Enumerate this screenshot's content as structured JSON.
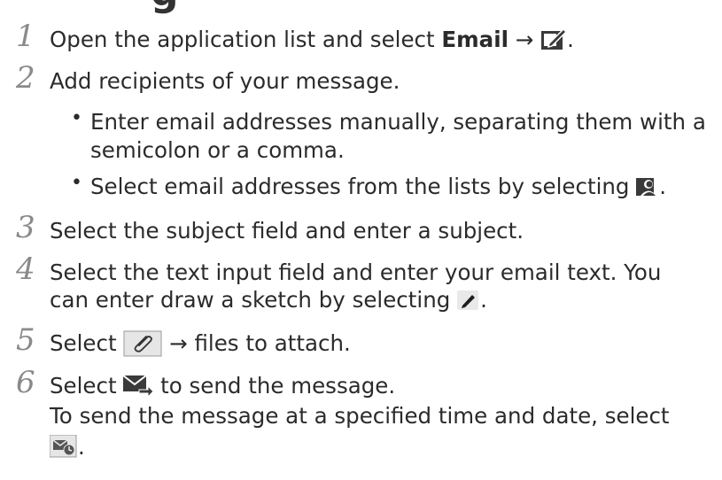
{
  "heading_partial": "g",
  "steps": [
    {
      "number": "1",
      "text_before": "Open the application list and select ",
      "bold": "Email",
      "arrow": "→",
      "icon": "compose-icon",
      "text_after": "."
    },
    {
      "number": "2",
      "text": "Add recipients of your message.",
      "bullets": [
        {
          "bullet": "•",
          "line1": "Enter email addresses manually, separating them with a",
          "line2": "semicolon or a comma."
        },
        {
          "bullet": "•",
          "text": "Select email addresses from the lists by selecting ",
          "icon": "contacts-icon",
          "text_after": "."
        }
      ]
    },
    {
      "number": "3",
      "text": "Select the subject field and enter a subject."
    },
    {
      "number": "4",
      "line1": "Select the text input field and enter your email text. You",
      "line2": "can enter draw a sketch by selecting ",
      "icon": "pen-icon",
      "text_after": "."
    },
    {
      "number": "5",
      "text_before": "Select ",
      "icon": "paperclip-icon",
      "arrow": "→",
      "text_after": " files to attach."
    },
    {
      "number": "6",
      "text_before": "Select ",
      "icon": "send-email-icon",
      "text_after": " to send the message.",
      "line2": "To send the message at a specified time and date, select",
      "icon2": "scheduled-send-icon",
      "text_after2": "."
    }
  ]
}
